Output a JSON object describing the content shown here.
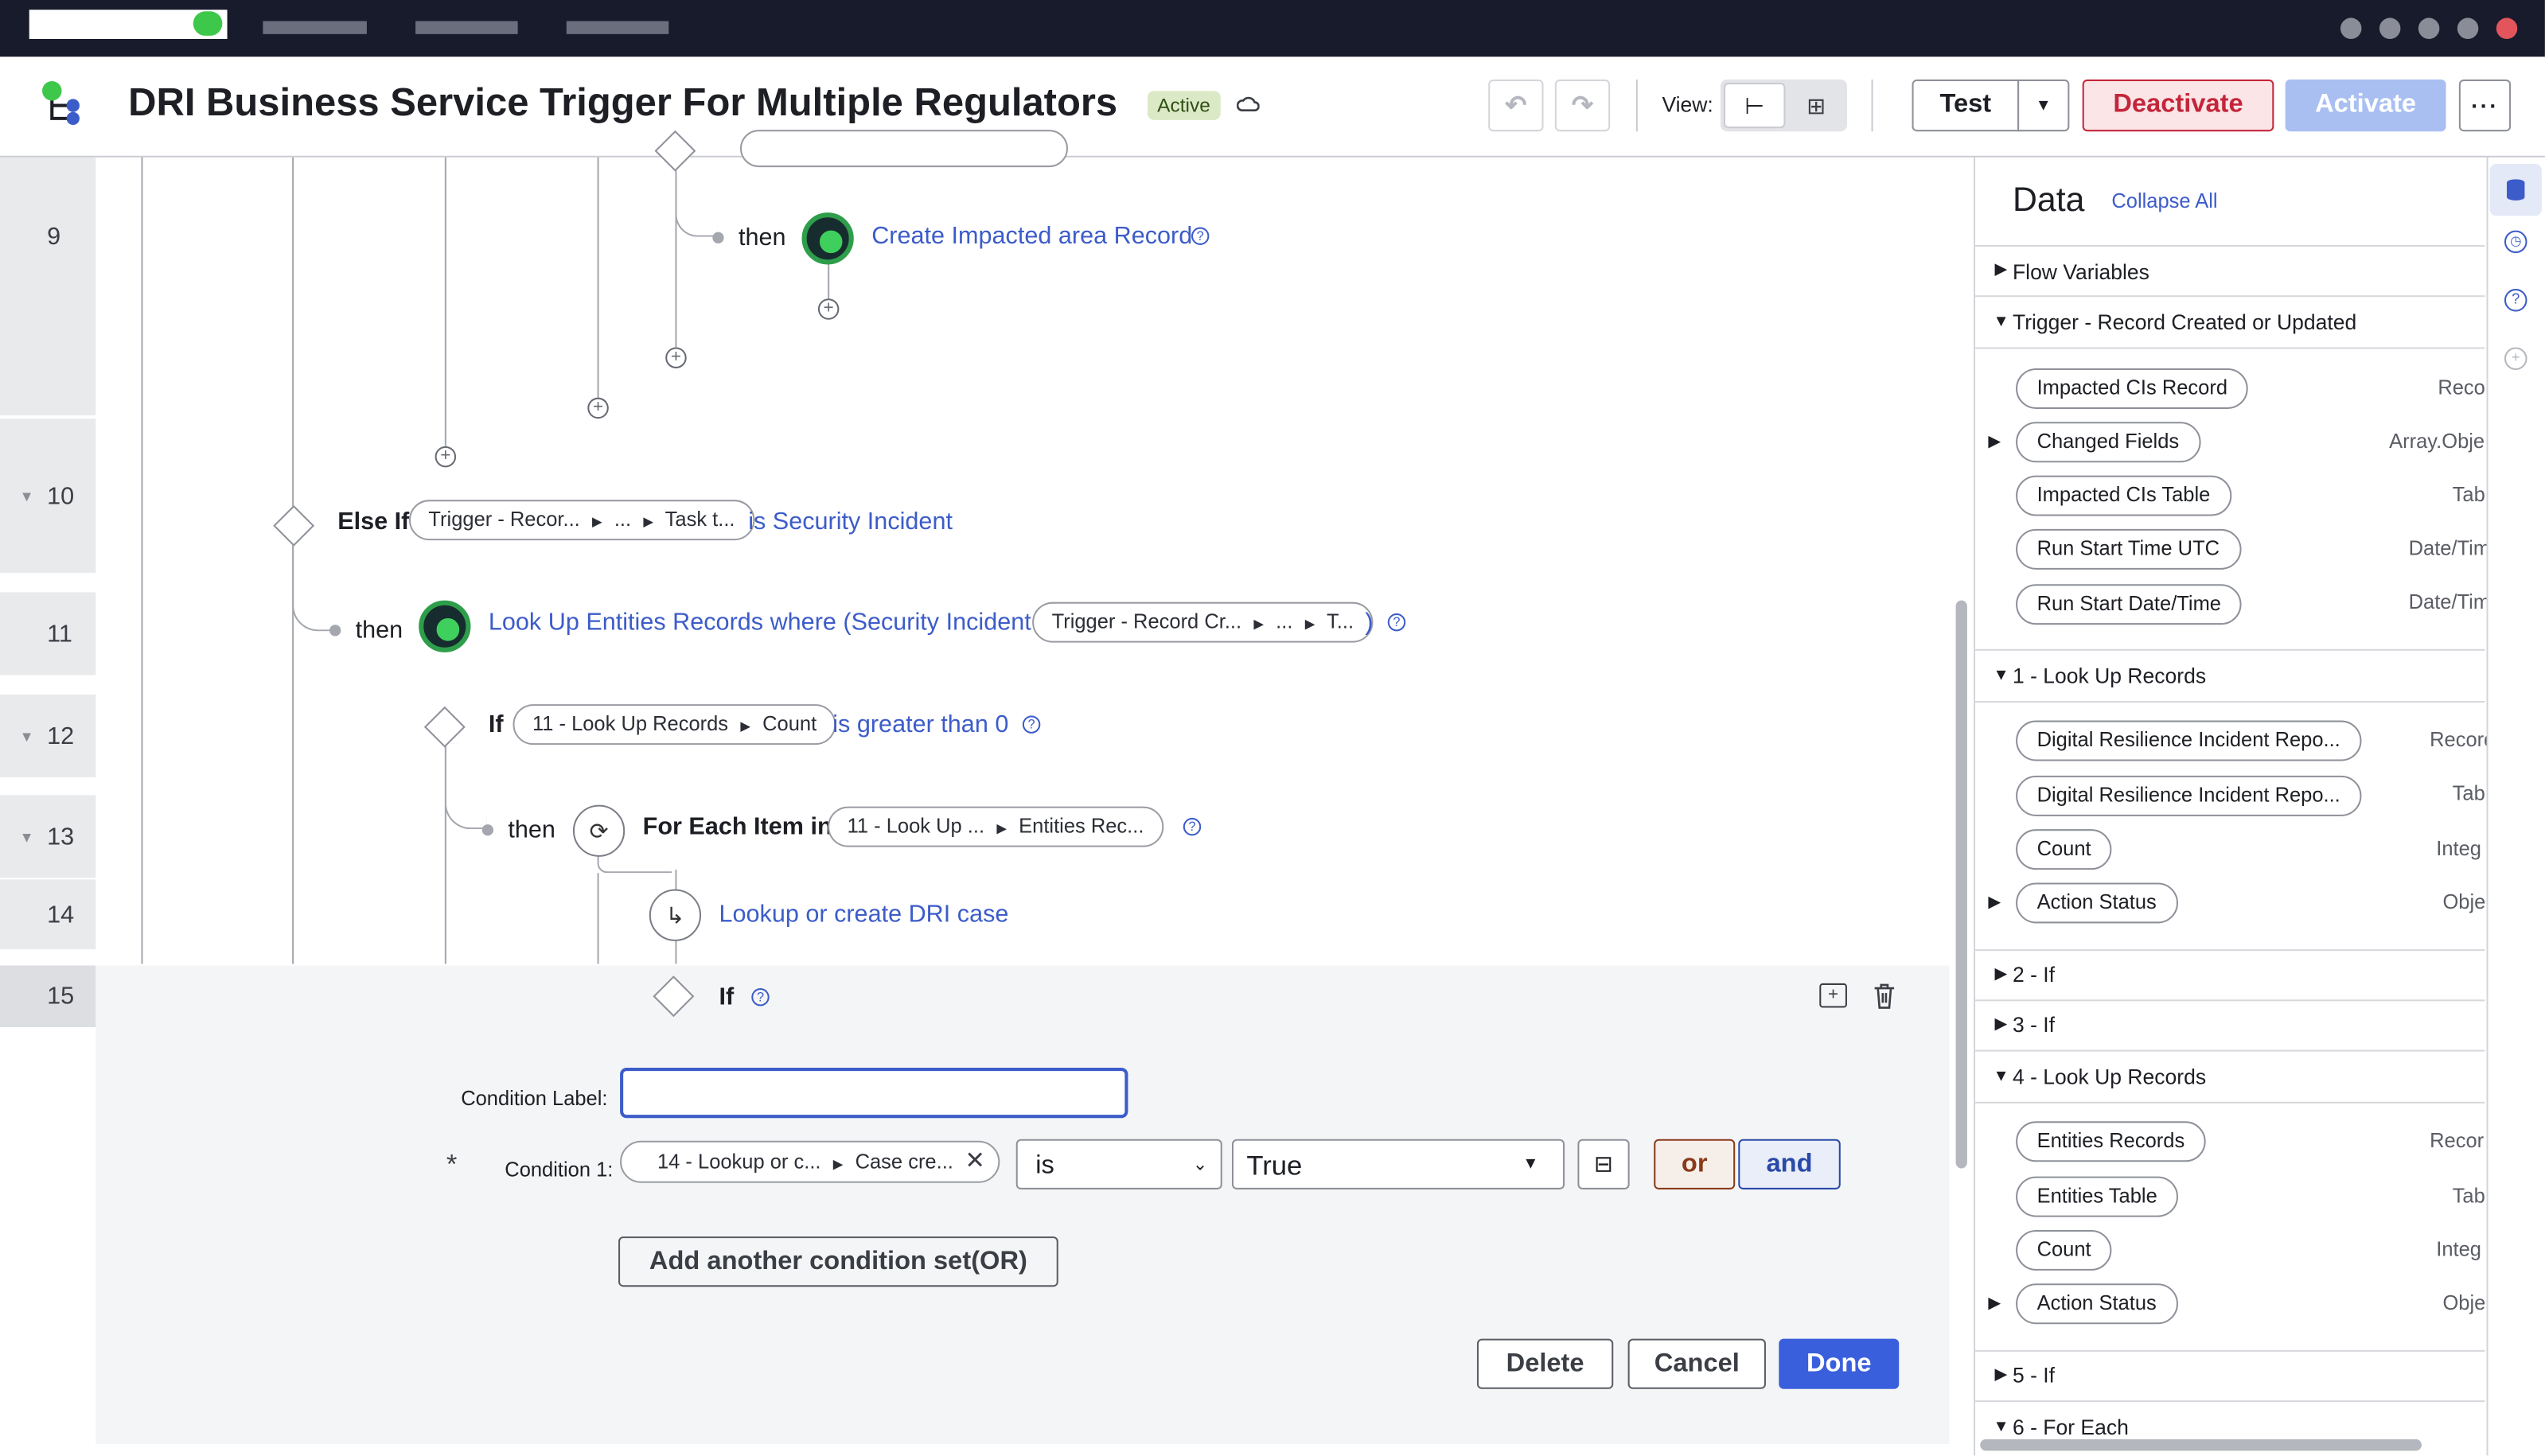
{
  "header": {
    "title": "DRI Business Service Trigger For Multiple Regulators",
    "status_badge": "Active",
    "view_label": "View:",
    "test_label": "Test",
    "deactivate_label": "Deactivate",
    "activate_label": "Activate"
  },
  "gutter": {
    "rows": [
      "9",
      "10",
      "11",
      "12",
      "13",
      "14",
      "15"
    ]
  },
  "flow": {
    "row9_then": "then",
    "row9_action": "Create Impacted area Record",
    "row10_kw": "Else If",
    "row10_pill_a": "Trigger - Recor...",
    "row10_pill_b": "...",
    "row10_pill_c": "Task t...",
    "row10_cond": "is Security Incident",
    "row11_then": "then",
    "row11_action": "Look Up Entities Records where (Security Incident is",
    "row11_pill_a": "Trigger - Record Cr...",
    "row11_pill_b": "...",
    "row11_pill_c": "T...",
    "row11_close": ")",
    "row12_kw": "If",
    "row12_pill_a": "11 - Look Up Records",
    "row12_pill_b": "Count",
    "row12_cond": "is greater than 0",
    "row13_then": "then",
    "row13_kw": "For Each Item in",
    "row13_pill_a": "11 - Look Up ...",
    "row13_pill_b": "Entities Rec...",
    "row14_action": "Lookup or create DRI case",
    "row15_kw": "If"
  },
  "editor": {
    "condition_label": "Condition Label:",
    "condition_label_value": "",
    "required_mark": "*",
    "condition1_label": "Condition 1:",
    "cond_pill_a": "14 - Lookup or c...",
    "cond_pill_b": "Case cre...",
    "operator_value": "is",
    "value_selected": "True",
    "or_label": "or",
    "and_label": "and",
    "add_condition_set_label": "Add another condition set(OR)",
    "delete_label": "Delete",
    "cancel_label": "Cancel",
    "done_label": "Done"
  },
  "data_panel": {
    "title": "Data",
    "collapse_all": "Collapse All",
    "sections": {
      "flow_variables": "Flow Variables",
      "trigger": "Trigger - Record Created or Updated",
      "look_up_1": "1 - Look Up Records",
      "if_2": "2 - If",
      "if_3": "3 - If",
      "look_up_4": "4 - Look Up Records",
      "if_5": "5 - If",
      "for_each_6": "6 - For Each"
    },
    "trigger_items": [
      {
        "label": "Impacted CIs Record",
        "type": "Recor"
      },
      {
        "label": "Changed Fields",
        "type": "Array.Obje"
      },
      {
        "label": "Impacted CIs Table",
        "type": "Tab"
      },
      {
        "label": "Run Start Time UTC",
        "type": "Date/Tim"
      },
      {
        "label": "Run Start Date/Time",
        "type": "Date/Tim"
      }
    ],
    "look_up_1_items": [
      {
        "label": "Digital Resilience Incident Repo...",
        "type": "Record"
      },
      {
        "label": "Digital Resilience Incident Repo...",
        "type": "Tab"
      },
      {
        "label": "Count",
        "type": "Integ"
      },
      {
        "label": "Action Status",
        "type": "Obje"
      }
    ],
    "look_up_4_items": [
      {
        "label": "Entities Records",
        "type": "Recor"
      },
      {
        "label": "Entities Table",
        "type": "Tab"
      },
      {
        "label": "Count",
        "type": "Integ"
      },
      {
        "label": "Action Status",
        "type": "Obje"
      }
    ]
  },
  "colors": {
    "accent": "#3c5cc9",
    "deactivate": "#c4253a",
    "activate_disabled": "#a9bff2",
    "active_badge": "#dce9c7",
    "topbar": "#171b2b"
  }
}
